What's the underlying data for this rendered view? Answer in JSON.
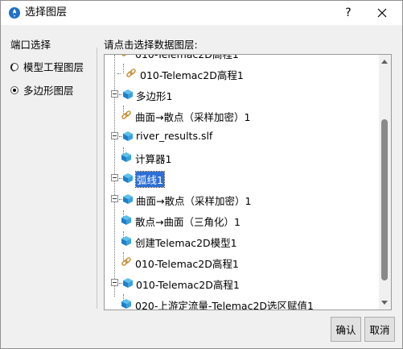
{
  "window": {
    "title": "选择图层",
    "help_label": "?",
    "close_label": "✕"
  },
  "left": {
    "label": "端口选择",
    "options": [
      {
        "label": "模型工程图层",
        "selected": false
      },
      {
        "label": "多边形图层",
        "selected": true
      }
    ]
  },
  "right": {
    "label": "请点击选择数据图层:"
  },
  "tree": {
    "rows": [
      {
        "label": "010-Telemac2D高程1",
        "icon": "link-icon",
        "level": 1,
        "expander": false,
        "selected": false,
        "partial": true
      },
      {
        "label": "010-Telemac2D高程1",
        "icon": "link-icon",
        "level": 1,
        "expander": false,
        "selected": false
      },
      {
        "label": "多边形1",
        "icon": "cube-icon",
        "level": 0,
        "expander": true,
        "selected": false
      },
      {
        "label": "曲面→散点（采样加密）1",
        "icon": "link-icon",
        "level": 1,
        "expander": false,
        "selected": false
      },
      {
        "label": "river_results.slf",
        "icon": "cube-icon",
        "level": 0,
        "expander": true,
        "selected": false
      },
      {
        "label": "计算器1",
        "icon": "cube-icon",
        "level": 1,
        "expander": false,
        "selected": false
      },
      {
        "label": "弧线1",
        "icon": "cube-icon",
        "level": 0,
        "expander": true,
        "selected": true
      },
      {
        "label": "曲面→散点（采样加密）1",
        "icon": "cube-icon",
        "level": 0,
        "expander": true,
        "selected": false
      },
      {
        "label": "散点→曲面（三角化）1",
        "icon": "cube-icon",
        "level": 1,
        "expander": false,
        "selected": false
      },
      {
        "label": "创建Telemac2D模型1",
        "icon": "cube-icon",
        "level": 1,
        "expander": false,
        "selected": false
      },
      {
        "label": "010-Telemac2D高程1",
        "icon": "link-icon",
        "level": 1,
        "expander": false,
        "selected": false
      },
      {
        "label": "010-Telemac2D高程1",
        "icon": "cube-icon",
        "level": 0,
        "expander": true,
        "selected": false
      },
      {
        "label": "020-上游定流量-Telemac2D选区赋值1",
        "icon": "cube-icon",
        "level": 1,
        "expander": false,
        "selected": false
      }
    ]
  },
  "buttons": {
    "ok": "确认",
    "cancel": "取消"
  },
  "colors": {
    "selection": "#2e6fd6",
    "cube_top": "#5bc0f0",
    "cube_side": "#1f7fc4",
    "link": "#c98a2e"
  }
}
